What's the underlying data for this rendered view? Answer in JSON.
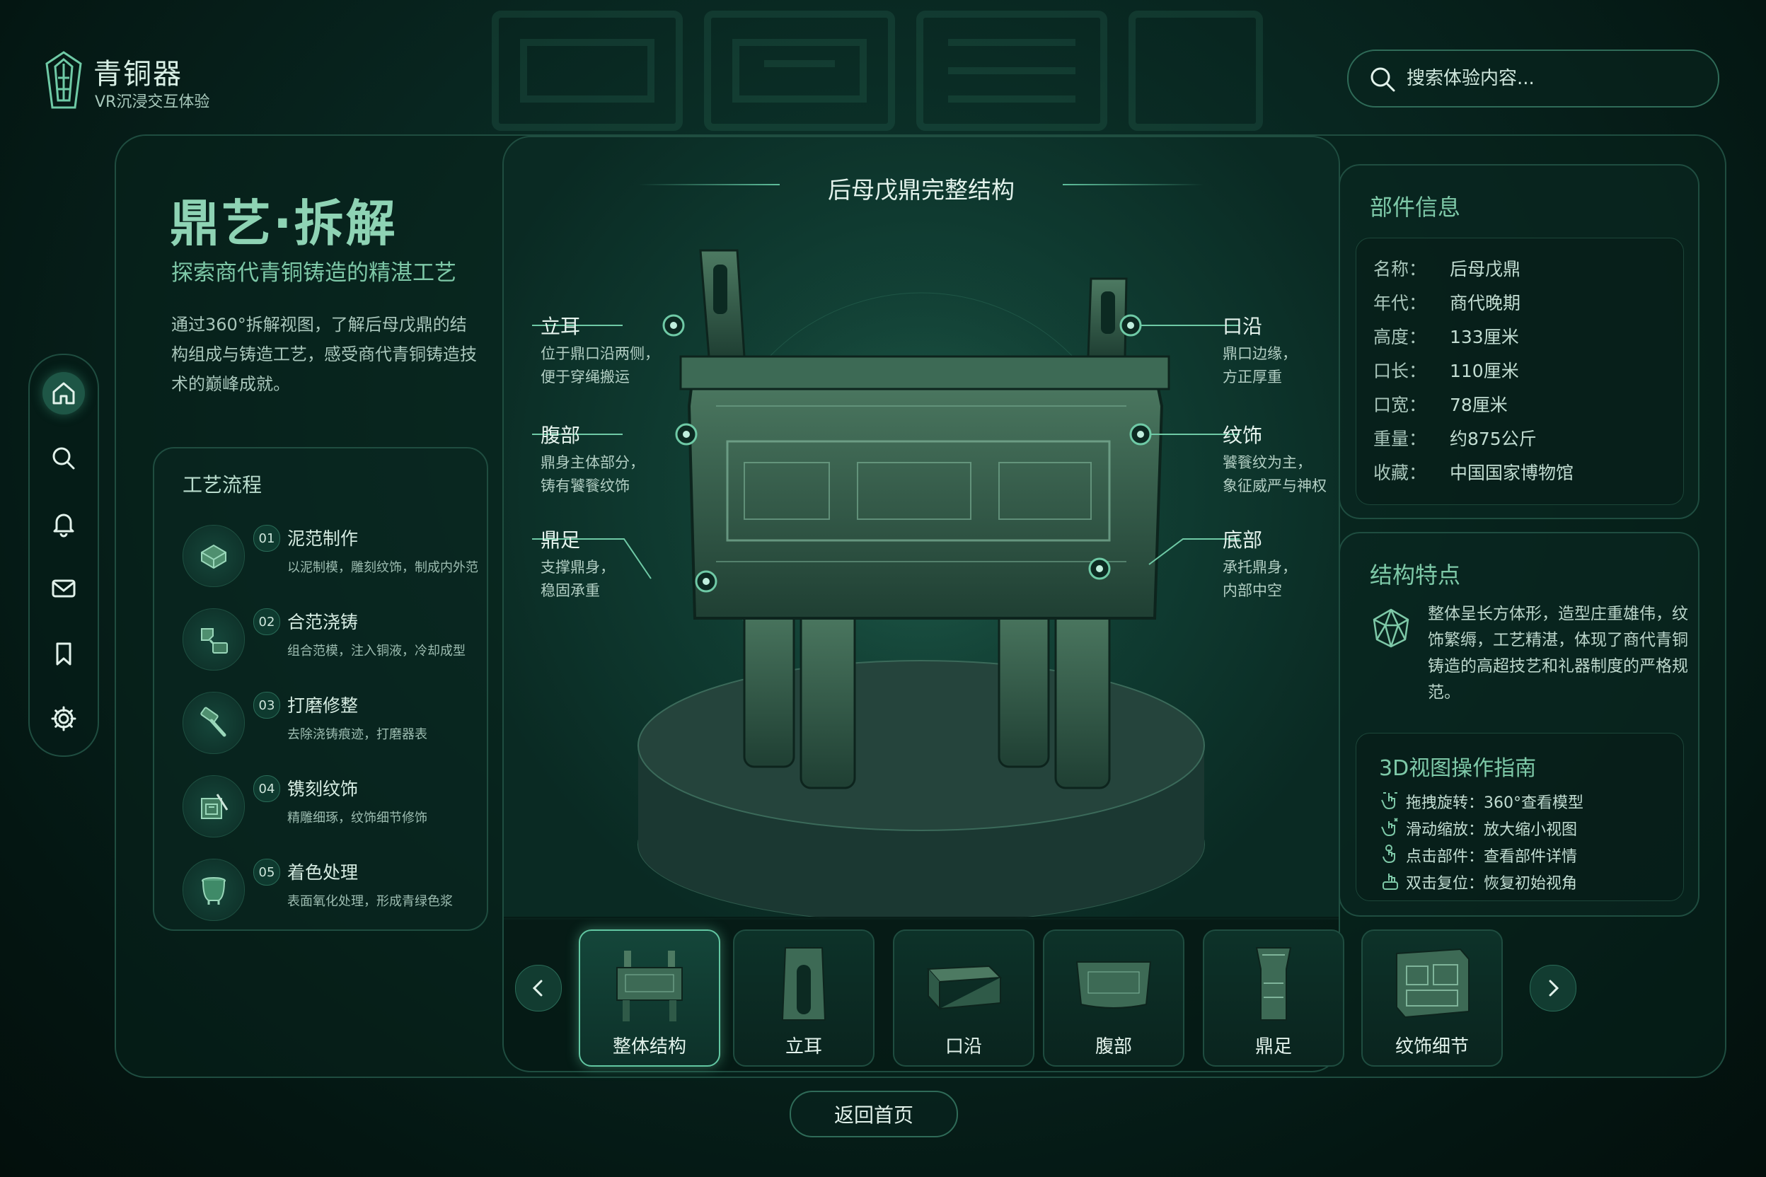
{
  "header": {
    "brand_title": "青铜器",
    "brand_subtitle": "VR沉浸交互体验",
    "search_placeholder": "搜索体验内容..."
  },
  "sidebar": {
    "items": [
      {
        "icon": "home-icon",
        "active": true
      },
      {
        "icon": "search-icon",
        "active": false
      },
      {
        "icon": "bell-icon",
        "active": false
      },
      {
        "icon": "mail-icon",
        "active": false
      },
      {
        "icon": "bookmark-icon",
        "active": false
      },
      {
        "icon": "gear-icon",
        "active": false
      }
    ]
  },
  "hero": {
    "title": "鼎艺·拆解",
    "subtitle": "探索商代青铜铸造的精湛工艺",
    "description": "通过360°拆解视图，了解后母戊鼎的结构组成与铸造工艺，感受商代青铜铸造技术的巅峰成就。"
  },
  "process": {
    "title": "工艺流程",
    "steps": [
      {
        "num": "01",
        "name": "泥范制作",
        "desc": "以泥制模，雕刻纹饰，制成内外范",
        "icon": "mold-icon"
      },
      {
        "num": "02",
        "name": "合范浇铸",
        "desc": "组合范模，注入铜液，冷却成型",
        "icon": "pour-icon"
      },
      {
        "num": "03",
        "name": "打磨修整",
        "desc": "去除浇铸痕迹，打磨器表",
        "icon": "hammer-icon"
      },
      {
        "num": "04",
        "name": "镌刻纹饰",
        "desc": "精雕细琢，纹饰细节修饰",
        "icon": "carve-icon"
      },
      {
        "num": "05",
        "name": "着色处理",
        "desc": "表面氧化处理，形成青绿色浆",
        "icon": "vessel-icon"
      }
    ]
  },
  "viewer": {
    "title": "后母戊鼎完整结构",
    "callouts": [
      {
        "name": "立耳",
        "desc": [
          "位于鼎口沿两侧，",
          "便于穿绳搬运"
        ]
      },
      {
        "name": "腹部",
        "desc": [
          "鼎身主体部分，",
          "铸有饕餮纹饰"
        ]
      },
      {
        "name": "鼎足",
        "desc": [
          "支撑鼎身，",
          "稳固承重"
        ]
      },
      {
        "name": "口沿",
        "desc": [
          "鼎口边缘，",
          "方正厚重"
        ]
      },
      {
        "name": "纹饰",
        "desc": [
          "饕餮纹为主，",
          "象征威严与神权"
        ]
      },
      {
        "name": "底部",
        "desc": [
          "承托鼎身，",
          "内部中空"
        ]
      }
    ]
  },
  "thumbnails": [
    {
      "label": "整体结构",
      "active": true
    },
    {
      "label": "立耳",
      "active": false
    },
    {
      "label": "口沿",
      "active": false
    },
    {
      "label": "腹部",
      "active": false
    },
    {
      "label": "鼎足",
      "active": false
    },
    {
      "label": "纹饰细节",
      "active": false
    }
  ],
  "info": {
    "title": "部件信息",
    "rows": [
      {
        "key": "名称：",
        "value": "后母戊鼎"
      },
      {
        "key": "年代：",
        "value": "商代晚期"
      },
      {
        "key": "高度：",
        "value": "133厘米"
      },
      {
        "key": "口长：",
        "value": "110厘米"
      },
      {
        "key": "口宽：",
        "value": "78厘米"
      },
      {
        "key": "重量：",
        "value": "约875公斤"
      },
      {
        "key": "收藏：",
        "value": "中国国家博物馆"
      }
    ]
  },
  "structure": {
    "title": "结构特点",
    "text": "整体呈长方体形，造型庄重雄伟，纹饰繁缛，工艺精湛，体现了商代青铜铸造的高超技艺和礼器制度的严格规范。"
  },
  "guide": {
    "title": "3D视图操作指南",
    "rows": [
      {
        "text": "拖拽旋转：360°查看模型",
        "icon": "drag-gesture-icon"
      },
      {
        "text": "滑动缩放：放大缩小视图",
        "icon": "pinch-gesture-icon"
      },
      {
        "text": "点击部件：查看部件详情",
        "icon": "tap-gesture-icon"
      },
      {
        "text": "双击复位：恢复初始视角",
        "icon": "reset-gesture-icon"
      }
    ]
  },
  "footer": {
    "home_button": "返回首页"
  },
  "colors": {
    "accent": "#7ec9a8",
    "background": "#082620",
    "border": "#1f4d40"
  }
}
